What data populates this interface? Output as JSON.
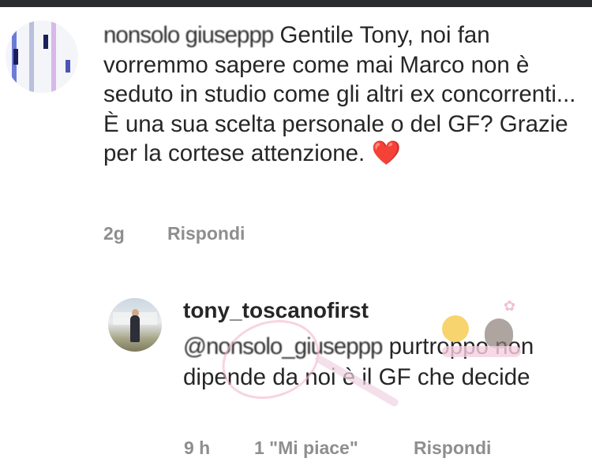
{
  "comment": {
    "username_obscured": "nonsolo giuseppp",
    "text": "Gentile Tony, noi fan vorremmo sapere come mai Marco non è seduto in studio come gli altri ex concorrenti... È una sua scelta personale o del GF? Grazie per la cortese attenzione.",
    "emoji": "❤️",
    "time": "2g",
    "reply_label": "Rispondi"
  },
  "reply": {
    "username": "tony_toscanofirst",
    "mention_obscured": "@nonsolo_giuseppp",
    "text": "purtroppo non dipende da noi è il GF che decide",
    "time": "9 h",
    "likes": "1 \"Mi piace\"",
    "reply_label": "Rispondi"
  },
  "colors": {
    "text": "#262626",
    "meta": "#8e8e8e",
    "heart": "#e0142d",
    "topbar": "#2b2c30"
  }
}
